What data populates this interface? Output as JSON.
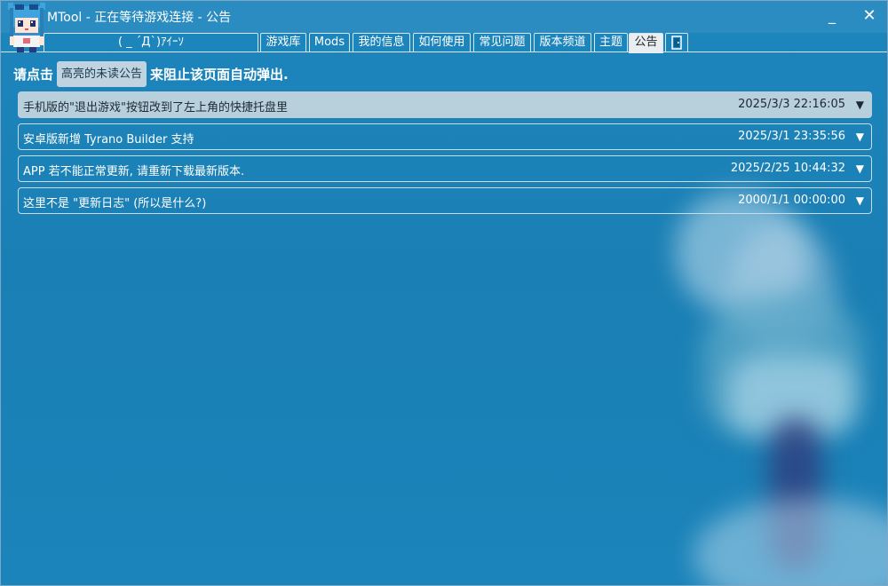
{
  "window": {
    "title": "MTool - 正在等待游戏连接 - 公告",
    "minimize_glyph": "_",
    "close_glyph": "✕"
  },
  "tabs": {
    "kaomoji": "( _ ´Д`)ｱｲｰｿ",
    "items": [
      {
        "label": "游戏库",
        "active": false
      },
      {
        "label": "Mods",
        "active": false
      },
      {
        "label": "我的信息",
        "active": false
      },
      {
        "label": "如何使用",
        "active": false
      },
      {
        "label": "常见问题",
        "active": false
      },
      {
        "label": "版本频道",
        "active": false
      },
      {
        "label": "主题",
        "active": false
      },
      {
        "label": "公告",
        "active": true
      }
    ],
    "exit_icon": "door-exit-icon"
  },
  "notice": {
    "prefix": "请点击",
    "button_label": "高亮的未读公告",
    "suffix": "来阻止该页面自动弹出."
  },
  "announcements": [
    {
      "title": "手机版的\"退出游戏\"按钮改到了左上角的快捷托盘里",
      "date": "2025/3/3 22:16:05",
      "highlighted": true
    },
    {
      "title": "安卓版新增 Tyrano Builder 支持",
      "date": "2025/3/1 23:35:56",
      "highlighted": false
    },
    {
      "title": "APP 若不能正常更新, 请重新下载最新版本.",
      "date": "2025/2/25 10:44:32",
      "highlighted": false
    },
    {
      "title": "这里不是 \"更新日志\" (所以是什么?)",
      "date": "2000/1/1 00:00:00",
      "highlighted": false
    }
  ],
  "expand_glyph": "▼",
  "colors": {
    "background": "#1a80b6",
    "titlebar": "#2a8cc1",
    "highlight_row": "#b8cfdc",
    "active_tab": "#e8eef2"
  }
}
